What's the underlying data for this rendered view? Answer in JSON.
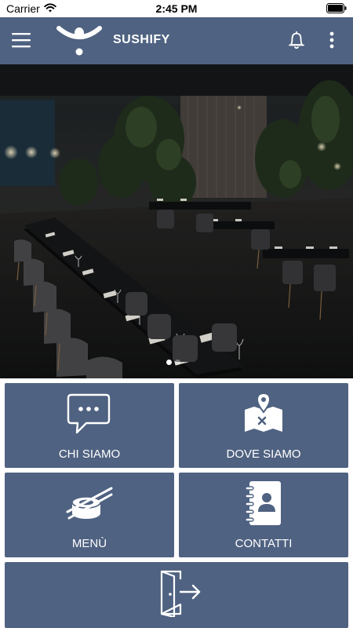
{
  "status_bar": {
    "carrier": "Carrier",
    "time": "2:45 PM",
    "icons": [
      "wifi-icon",
      "battery-icon"
    ]
  },
  "header": {
    "title": "SUSHIFY",
    "icons": [
      "menu-icon",
      "logo-icon",
      "bell-icon",
      "more-vertical-icon"
    ],
    "background": "#4f6281"
  },
  "hero": {
    "image": "restaurant-interior-photo",
    "pagination_active": 1,
    "pagination_total": 2
  },
  "tiles": [
    {
      "id": "chi-siamo",
      "label": "CHI SIAMO",
      "icon": "chat-bubble-icon"
    },
    {
      "id": "dove-siamo",
      "label": "DOVE SIAMO",
      "icon": "map-pin-icon"
    },
    {
      "id": "menu",
      "label": "MENÙ",
      "icon": "sushi-chopsticks-icon"
    },
    {
      "id": "contatti",
      "label": "CONTATTI",
      "icon": "address-book-icon"
    },
    {
      "id": "exit",
      "label": "",
      "icon": "logout-door-icon"
    }
  ],
  "colors": {
    "primary": "#4f6281",
    "text_on_primary": "#ffffff"
  }
}
